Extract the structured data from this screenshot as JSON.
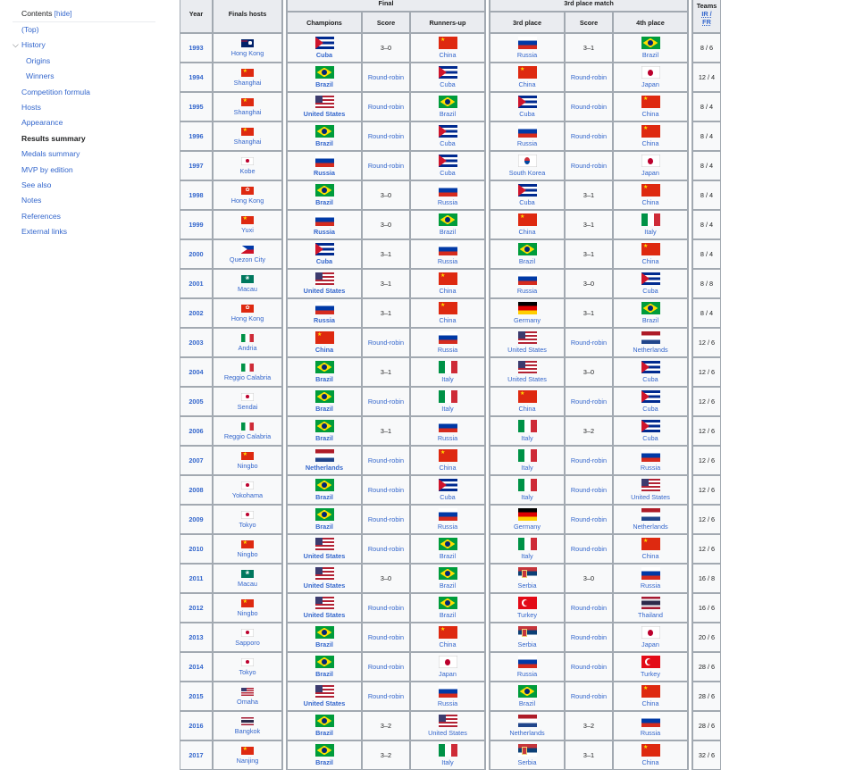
{
  "toc": {
    "title": "Contents",
    "hide_label": "[hide]",
    "items": [
      {
        "label": "(Top)",
        "level": 0
      },
      {
        "label": "History",
        "level": 0,
        "expanded": true
      },
      {
        "label": "Origins",
        "level": 1
      },
      {
        "label": "Winners",
        "level": 1
      },
      {
        "label": "Competition formula",
        "level": 0
      },
      {
        "label": "Hosts",
        "level": 0
      },
      {
        "label": "Appearance",
        "level": 0
      },
      {
        "label": "Results summary",
        "level": 0,
        "active": true
      },
      {
        "label": "Medals summary",
        "level": 0
      },
      {
        "label": "MVP by edition",
        "level": 0
      },
      {
        "label": "See also",
        "level": 0
      },
      {
        "label": "Notes",
        "level": 0
      },
      {
        "label": "References",
        "level": 0
      },
      {
        "label": "External links",
        "level": 0
      }
    ]
  },
  "table": {
    "headers": {
      "year": "Year",
      "finals_hosts": "Finals hosts",
      "final": "Final",
      "third_place_match": "3rd place match",
      "teams": "Teams",
      "teams_sub1": "IR /",
      "teams_sub2": "FR",
      "champions": "Champions",
      "score": "Score",
      "runners_up": "Runners-up",
      "third_place": "3rd place",
      "score2": "Score",
      "fourth_place": "4th place"
    },
    "rows": [
      {
        "year": "1993",
        "host": "Hong Kong",
        "host_flag": "hk_colonial",
        "champion": "Cuba",
        "champion_flag": "cuba",
        "score": "3–0",
        "runner_up": "China",
        "runner_up_flag": "china",
        "third": "Russia",
        "third_flag": "russia",
        "score2": "3–1",
        "fourth": "Brazil",
        "fourth_flag": "brazil",
        "teams": "8 / 6"
      },
      {
        "year": "1994",
        "host": "Shanghai",
        "host_flag": "china",
        "champion": "Brazil",
        "champion_flag": "brazil",
        "score": "Round-robin",
        "runner_up": "Cuba",
        "runner_up_flag": "cuba",
        "third": "China",
        "third_flag": "china",
        "score2": "Round-robin",
        "fourth": "Japan",
        "fourth_flag": "japan",
        "teams": "12 / 4"
      },
      {
        "year": "1995",
        "host": "Shanghai",
        "host_flag": "china",
        "champion": "United States",
        "champion_flag": "usa",
        "score": "Round-robin",
        "runner_up": "Brazil",
        "runner_up_flag": "brazil",
        "third": "Cuba",
        "third_flag": "cuba",
        "score2": "Round-robin",
        "fourth": "China",
        "fourth_flag": "china",
        "teams": "8 / 4"
      },
      {
        "year": "1996",
        "host": "Shanghai",
        "host_flag": "china",
        "champion": "Brazil",
        "champion_flag": "brazil",
        "score": "Round-robin",
        "runner_up": "Cuba",
        "runner_up_flag": "cuba",
        "third": "Russia",
        "third_flag": "russia",
        "score2": "Round-robin",
        "fourth": "China",
        "fourth_flag": "china",
        "teams": "8 / 4"
      },
      {
        "year": "1997",
        "host": "Kobe",
        "host_flag": "japan",
        "champion": "Russia",
        "champion_flag": "russia",
        "score": "Round-robin",
        "runner_up": "Cuba",
        "runner_up_flag": "cuba",
        "third": "South Korea",
        "third_flag": "korea",
        "score2": "Round-robin",
        "fourth": "Japan",
        "fourth_flag": "japan",
        "teams": "8 / 4"
      },
      {
        "year": "1998",
        "host": "Hong Kong",
        "host_flag": "hongkong",
        "champion": "Brazil",
        "champion_flag": "brazil",
        "score": "3–0",
        "runner_up": "Russia",
        "runner_up_flag": "russia",
        "third": "Cuba",
        "third_flag": "cuba",
        "score2": "3–1",
        "fourth": "China",
        "fourth_flag": "china",
        "teams": "8 / 4"
      },
      {
        "year": "1999",
        "host": "Yuxi",
        "host_flag": "china",
        "champion": "Russia",
        "champion_flag": "russia",
        "score": "3–0",
        "runner_up": "Brazil",
        "runner_up_flag": "brazil",
        "third": "China",
        "third_flag": "china",
        "score2": "3–1",
        "fourth": "Italy",
        "fourth_flag": "italy",
        "teams": "8 / 4"
      },
      {
        "year": "2000",
        "host": "Quezon City",
        "host_flag": "philippines",
        "champion": "Cuba",
        "champion_flag": "cuba",
        "score": "3–1",
        "runner_up": "Russia",
        "runner_up_flag": "russia",
        "third": "Brazil",
        "third_flag": "brazil",
        "score2": "3–1",
        "fourth": "China",
        "fourth_flag": "china",
        "teams": "8 / 4"
      },
      {
        "year": "2001",
        "host": "Macau",
        "host_flag": "macau",
        "champion": "United States",
        "champion_flag": "usa",
        "score": "3–1",
        "runner_up": "China",
        "runner_up_flag": "china",
        "third": "Russia",
        "third_flag": "russia",
        "score2": "3–0",
        "fourth": "Cuba",
        "fourth_flag": "cuba",
        "teams": "8 / 8"
      },
      {
        "year": "2002",
        "host": "Hong Kong",
        "host_flag": "hongkong",
        "champion": "Russia",
        "champion_flag": "russia",
        "score": "3–1",
        "runner_up": "China",
        "runner_up_flag": "china",
        "third": "Germany",
        "third_flag": "germany",
        "score2": "3–1",
        "fourth": "Brazil",
        "fourth_flag": "brazil",
        "teams": "8 / 4"
      },
      {
        "year": "2003",
        "host": "Andria",
        "host_flag": "italy",
        "champion": "China",
        "champion_flag": "china",
        "score": "Round-robin",
        "runner_up": "Russia",
        "runner_up_flag": "russia",
        "third": "United States",
        "third_flag": "usa",
        "score2": "Round-robin",
        "fourth": "Netherlands",
        "fourth_flag": "netherlands",
        "teams": "12 / 6"
      },
      {
        "year": "2004",
        "host": "Reggio Calabria",
        "host_flag": "italy",
        "champion": "Brazil",
        "champion_flag": "brazil",
        "score": "3–1",
        "runner_up": "Italy",
        "runner_up_flag": "italy",
        "third": "United States",
        "third_flag": "usa",
        "score2": "3–0",
        "fourth": "Cuba",
        "fourth_flag": "cuba",
        "teams": "12 / 6"
      },
      {
        "year": "2005",
        "host": "Sendai",
        "host_flag": "japan",
        "champion": "Brazil",
        "champion_flag": "brazil",
        "score": "Round-robin",
        "runner_up": "Italy",
        "runner_up_flag": "italy",
        "third": "China",
        "third_flag": "china",
        "score2": "Round-robin",
        "fourth": "Cuba",
        "fourth_flag": "cuba",
        "teams": "12 / 6"
      },
      {
        "year": "2006",
        "host": "Reggio Calabria",
        "host_flag": "italy",
        "champion": "Brazil",
        "champion_flag": "brazil",
        "score": "3–1",
        "runner_up": "Russia",
        "runner_up_flag": "russia",
        "third": "Italy",
        "third_flag": "italy",
        "score2": "3–2",
        "fourth": "Cuba",
        "fourth_flag": "cuba",
        "teams": "12 / 6"
      },
      {
        "year": "2007",
        "host": "Ningbo",
        "host_flag": "china",
        "champion": "Netherlands",
        "champion_flag": "netherlands",
        "score": "Round-robin",
        "runner_up": "China",
        "runner_up_flag": "china",
        "third": "Italy",
        "third_flag": "italy",
        "score2": "Round-robin",
        "fourth": "Russia",
        "fourth_flag": "russia",
        "teams": "12 / 6"
      },
      {
        "year": "2008",
        "host": "Yokohama",
        "host_flag": "japan",
        "champion": "Brazil",
        "champion_flag": "brazil",
        "score": "Round-robin",
        "runner_up": "Cuba",
        "runner_up_flag": "cuba",
        "third": "Italy",
        "third_flag": "italy",
        "score2": "Round-robin",
        "fourth": "United States",
        "fourth_flag": "usa",
        "teams": "12 / 6"
      },
      {
        "year": "2009",
        "host": "Tokyo",
        "host_flag": "japan",
        "champion": "Brazil",
        "champion_flag": "brazil",
        "score": "Round-robin",
        "runner_up": "Russia",
        "runner_up_flag": "russia",
        "third": "Germany",
        "third_flag": "germany",
        "score2": "Round-robin",
        "fourth": "Netherlands",
        "fourth_flag": "netherlands",
        "teams": "12 / 6"
      },
      {
        "year": "2010",
        "host": "Ningbo",
        "host_flag": "china",
        "champion": "United States",
        "champion_flag": "usa",
        "score": "Round-robin",
        "runner_up": "Brazil",
        "runner_up_flag": "brazil",
        "third": "Italy",
        "third_flag": "italy",
        "score2": "Round-robin",
        "fourth": "China",
        "fourth_flag": "china",
        "teams": "12 / 6"
      },
      {
        "year": "2011",
        "host": "Macau",
        "host_flag": "macau",
        "champion": "United States",
        "champion_flag": "usa",
        "score": "3–0",
        "runner_up": "Brazil",
        "runner_up_flag": "brazil",
        "third": "Serbia",
        "third_flag": "serbia",
        "score2": "3–0",
        "fourth": "Russia",
        "fourth_flag": "russia",
        "teams": "16 / 8"
      },
      {
        "year": "2012",
        "host": "Ningbo",
        "host_flag": "china",
        "champion": "United States",
        "champion_flag": "usa",
        "score": "Round-robin",
        "runner_up": "Brazil",
        "runner_up_flag": "brazil",
        "third": "Turkey",
        "third_flag": "turkey",
        "score2": "Round-robin",
        "fourth": "Thailand",
        "fourth_flag": "thailand",
        "teams": "16 / 6"
      },
      {
        "year": "2013",
        "host": "Sapporo",
        "host_flag": "japan",
        "champion": "Brazil",
        "champion_flag": "brazil",
        "score": "Round-robin",
        "runner_up": "China",
        "runner_up_flag": "china",
        "third": "Serbia",
        "third_flag": "serbia",
        "score2": "Round-robin",
        "fourth": "Japan",
        "fourth_flag": "japan",
        "teams": "20 / 6"
      },
      {
        "year": "2014",
        "host": "Tokyo",
        "host_flag": "japan",
        "champion": "Brazil",
        "champion_flag": "brazil",
        "score": "Round-robin",
        "runner_up": "Japan",
        "runner_up_flag": "japan",
        "third": "Russia",
        "third_flag": "russia",
        "score2": "Round-robin",
        "fourth": "Turkey",
        "fourth_flag": "turkey",
        "teams": "28 / 6"
      },
      {
        "year": "2015",
        "host": "Omaha",
        "host_flag": "usa",
        "champion": "United States",
        "champion_flag": "usa",
        "score": "Round-robin",
        "runner_up": "Russia",
        "runner_up_flag": "russia",
        "third": "Brazil",
        "third_flag": "brazil",
        "score2": "Round-robin",
        "fourth": "China",
        "fourth_flag": "china",
        "teams": "28 / 6"
      },
      {
        "year": "2016",
        "host": "Bangkok",
        "host_flag": "thailand",
        "champion": "Brazil",
        "champion_flag": "brazil",
        "score": "3–2",
        "runner_up": "United States",
        "runner_up_flag": "usa",
        "third": "Netherlands",
        "third_flag": "netherlands",
        "score2": "3–2",
        "fourth": "Russia",
        "fourth_flag": "russia",
        "teams": "28 / 6"
      },
      {
        "year": "2017",
        "host": "Nanjing",
        "host_flag": "china",
        "champion": "Brazil",
        "champion_flag": "brazil",
        "score": "3–2",
        "runner_up": "Italy",
        "runner_up_flag": "italy",
        "third": "Serbia",
        "third_flag": "serbia",
        "score2": "3–1",
        "fourth": "China",
        "fourth_flag": "china",
        "teams": "32 / 6"
      }
    ]
  },
  "colors": {
    "link": "#3366cc",
    "header_bg": "#eaecf0",
    "cell_bg": "#f8f9fa",
    "border": "#a2a9b1"
  }
}
